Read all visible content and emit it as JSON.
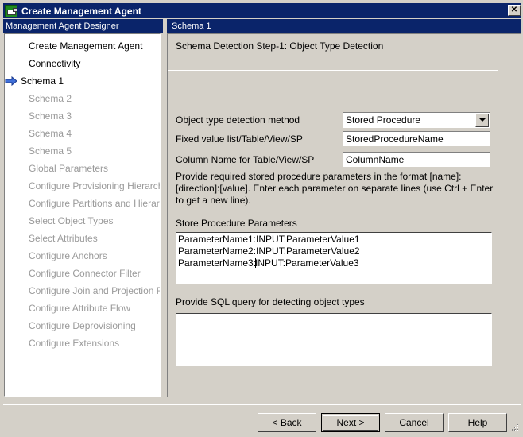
{
  "window": {
    "title": "Create Management Agent",
    "icon": "agent-icon",
    "close_label": "✕"
  },
  "headers": {
    "left": "Management Agent Designer",
    "right": "Schema 1"
  },
  "sidebar": {
    "items": [
      {
        "label": "Create Management Agent",
        "state": "done"
      },
      {
        "label": "Connectivity",
        "state": "done"
      },
      {
        "label": "Schema 1",
        "state": "current"
      },
      {
        "label": "Schema 2",
        "state": "pending"
      },
      {
        "label": "Schema 3",
        "state": "pending"
      },
      {
        "label": "Schema 4",
        "state": "pending"
      },
      {
        "label": "Schema 5",
        "state": "pending"
      },
      {
        "label": "Global Parameters",
        "state": "pending"
      },
      {
        "label": "Configure Provisioning Hierarchy",
        "state": "pending"
      },
      {
        "label": "Configure Partitions and Hierarchies",
        "state": "pending"
      },
      {
        "label": "Select Object Types",
        "state": "pending"
      },
      {
        "label": "Select Attributes",
        "state": "pending"
      },
      {
        "label": "Configure Anchors",
        "state": "pending"
      },
      {
        "label": "Configure Connector Filter",
        "state": "pending"
      },
      {
        "label": "Configure Join and Projection Rules",
        "state": "pending"
      },
      {
        "label": "Configure Attribute Flow",
        "state": "pending"
      },
      {
        "label": "Configure Deprovisioning",
        "state": "pending"
      },
      {
        "label": "Configure Extensions",
        "state": "pending"
      }
    ]
  },
  "main": {
    "step_title": "Schema Detection Step-1: Object Type Detection",
    "fields": {
      "method_label": "Object type detection method",
      "method_value": "Stored Procedure",
      "fixed_value_label": "Fixed value list/Table/View/SP",
      "fixed_value_value": "StoredProcedureName",
      "column_name_label": "Column Name for Table/View/SP",
      "column_name_value": "ColumnName"
    },
    "help_text": "Provide required stored procedure parameters in the format [name]:[direction]:[value]. Enter each parameter on separate lines (use Ctrl + Enter to get a new line).",
    "params_label": "Store Procedure Parameters",
    "params_lines": [
      "ParameterName1:INPUT:ParameterValue1",
      "ParameterName2:INPUT:ParameterValue2",
      "ParameterName3:INPUT:ParameterValue3"
    ],
    "params_caret_line": 2,
    "params_caret_col": 15,
    "sql_label": "Provide SQL query for detecting object types",
    "sql_value": ""
  },
  "scrollbar": {
    "up_icon": "triangle-up-icon",
    "down_icon": "triangle-down-icon"
  },
  "buttons": {
    "back_prefix": "< ",
    "back_u": "B",
    "back_suffix": "ack",
    "next_prefix": "",
    "next_u": "N",
    "next_suffix": "ext >",
    "cancel": "Cancel",
    "help": "Help"
  },
  "colors": {
    "titlebar": "#0a246a",
    "face": "#d4d0c8",
    "field_bg": "#ffffff",
    "disabled_text": "#9a9a9a",
    "arrow_blue": "#1f40b5"
  }
}
